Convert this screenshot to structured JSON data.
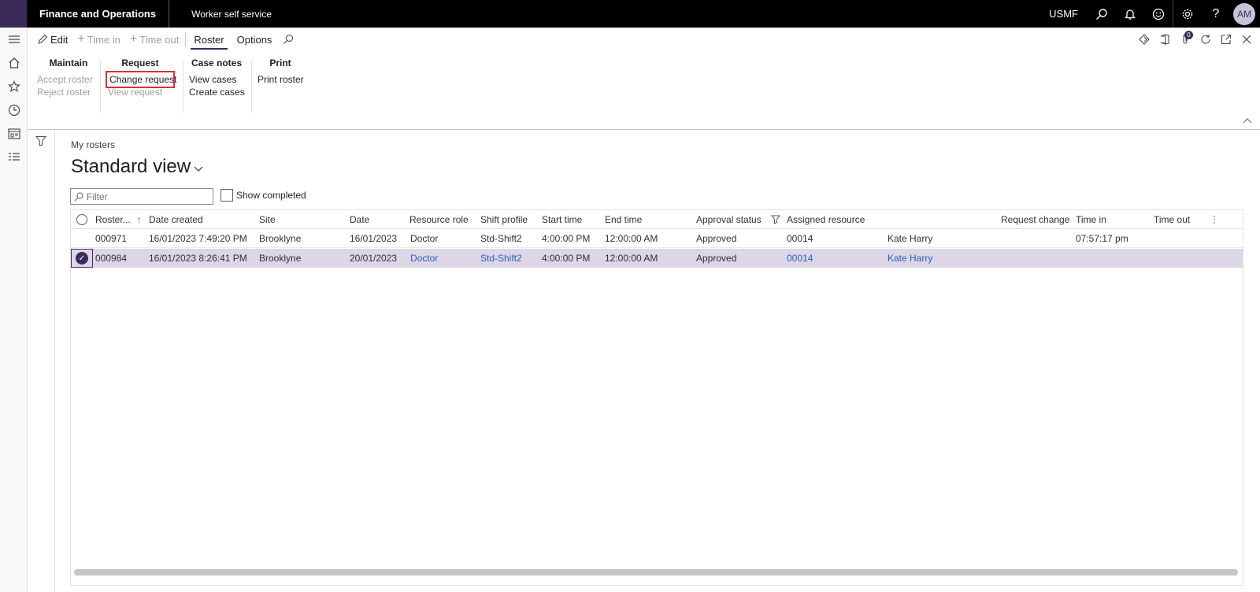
{
  "topbar": {
    "app_title": "Finance and Operations",
    "module_title": "Worker self service",
    "company": "USMF",
    "avatar_initials": "AM"
  },
  "actionbar": {
    "edit": "Edit",
    "time_in": "Time in",
    "time_out": "Time out",
    "tab_roster": "Roster",
    "tab_options": "Options",
    "attachments_count": "0"
  },
  "ribbon": {
    "maintain": {
      "title": "Maintain",
      "items": [
        "Accept roster",
        "Reject roster"
      ]
    },
    "request": {
      "title": "Request",
      "items": [
        "Change request",
        "View request"
      ]
    },
    "case_notes": {
      "title": "Case notes",
      "items": [
        "View cases",
        "Create cases"
      ]
    },
    "print": {
      "title": "Print",
      "items": [
        "Print roster"
      ]
    }
  },
  "page": {
    "breadcrumb": "My rosters",
    "view_title": "Standard view",
    "filter_placeholder": "Filter",
    "show_completed": "Show completed"
  },
  "grid": {
    "columns": [
      "Roster...",
      "Date created",
      "Site",
      "Date",
      "Resource role",
      "Shift profile",
      "Start time",
      "End time",
      "Approval status",
      "Assigned resource",
      "Request change",
      "Time in",
      "Time out"
    ],
    "rows": [
      {
        "roster": "000971",
        "date_created": "16/01/2023 7:49:20 PM",
        "site": "Brooklyne",
        "date": "16/01/2023",
        "resource_role": "Doctor",
        "shift_profile": "Std-Shift2",
        "start_time": "4:00:00 PM",
        "end_time": "12:00:00 AM",
        "approval_status": "Approved",
        "assigned_resource": "00014",
        "resource_name": "Kate Harry",
        "request_change": "",
        "time_in": "07:57:17 pm",
        "time_out": ""
      },
      {
        "roster": "000984",
        "date_created": "16/01/2023 8:26:41 PM",
        "site": "Brooklyne",
        "date": "20/01/2023",
        "resource_role": "Doctor",
        "shift_profile": "Std-Shift2",
        "start_time": "4:00:00 PM",
        "end_time": "12:00:00 AM",
        "approval_status": "Approved",
        "assigned_resource": "00014",
        "resource_name": "Kate Harry",
        "request_change": "",
        "time_in": "",
        "time_out": ""
      }
    ]
  }
}
